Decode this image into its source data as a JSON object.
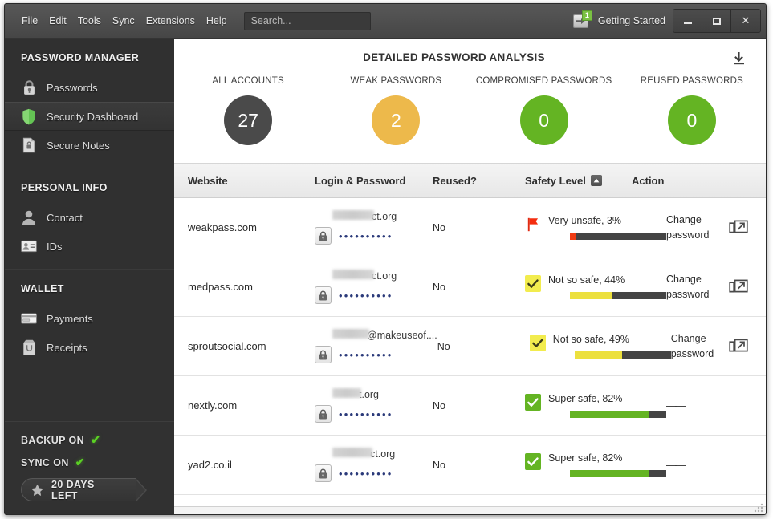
{
  "titlebar": {
    "menus": [
      "File",
      "Edit",
      "Tools",
      "Sync",
      "Extensions",
      "Help"
    ],
    "search_placeholder": "Search...",
    "getting_started_label": "Getting Started",
    "getting_started_badge": "1",
    "minimize_label": "Minimize",
    "maximize_label": "Maximize",
    "close_label": "✕"
  },
  "sidebar": {
    "sections": [
      {
        "title": "PASSWORD MANAGER",
        "items": [
          {
            "label": "Passwords",
            "icon": "lock-icon",
            "active": false
          },
          {
            "label": "Security Dashboard",
            "icon": "shield-icon",
            "active": true
          },
          {
            "label": "Secure Notes",
            "icon": "note-lock-icon",
            "active": false
          }
        ]
      },
      {
        "title": "PERSONAL INFO",
        "items": [
          {
            "label": "Contact",
            "icon": "person-icon",
            "active": false
          },
          {
            "label": "IDs",
            "icon": "id-card-icon",
            "active": false
          }
        ]
      },
      {
        "title": "WALLET",
        "items": [
          {
            "label": "Payments",
            "icon": "credit-card-icon",
            "active": false
          },
          {
            "label": "Receipts",
            "icon": "receipt-bag-icon",
            "active": false
          }
        ]
      }
    ],
    "footer": {
      "backup_label": "BACKUP ON",
      "backup_check": "✔",
      "sync_label": "SYNC ON",
      "sync_check": "✔",
      "trial_label": "20 DAYS LEFT",
      "trial_icon": "star-icon"
    }
  },
  "main": {
    "title": "DETAILED PASSWORD ANALYSIS",
    "download_icon": "download-icon",
    "stats": [
      {
        "label": "ALL ACCOUNTS",
        "value": "27",
        "color": "#4a4a4a"
      },
      {
        "label": "WEAK PASSWORDS",
        "value": "2",
        "color": "#edb94b"
      },
      {
        "label": "COMPROMISED PASSWORDS",
        "value": "0",
        "color": "#64b423"
      },
      {
        "label": "REUSED PASSWORDS",
        "value": "0",
        "color": "#64b423"
      }
    ],
    "table": {
      "columns": [
        "Website",
        "Login & Password",
        "Reused?",
        "Safety Level",
        "Action"
      ],
      "sorted_column": "Safety Level",
      "sort_direction": "asc",
      "password_mask": "••••••••••",
      "rows": [
        {
          "website": "weakpass.com",
          "login_redacted_width": 52,
          "login_tail": "ct.org",
          "reused": "No",
          "safety_label": "Very unsafe, 3%",
          "safety_percent": 3,
          "safety_color": "#f03c14",
          "safety_icon": "red-flag-icon",
          "action": "Change password",
          "has_launch_icon": true
        },
        {
          "website": "medpass.com",
          "login_redacted_width": 52,
          "login_tail": "ct.org",
          "reused": "No",
          "safety_label": "Not so safe, 44%",
          "safety_percent": 44,
          "safety_color": "#ece03e",
          "safety_icon": "yellow-check-icon",
          "action": "Change password",
          "has_launch_icon": true
        },
        {
          "website": "sproutsocial.com",
          "login_redacted_width": 46,
          "login_tail": "@makeuseof....",
          "reused": "No",
          "safety_label": "Not so safe, 49%",
          "safety_percent": 49,
          "safety_color": "#ece03e",
          "safety_icon": "yellow-check-icon",
          "action": "Change password",
          "has_launch_icon": true
        },
        {
          "website": "nextly.com",
          "login_redacted_width": 36,
          "login_tail": "t.org",
          "reused": "No",
          "safety_label": "Super safe, 82%",
          "safety_percent": 82,
          "safety_color": "#64b423",
          "safety_icon": "green-check-icon",
          "action": "——",
          "has_launch_icon": false
        },
        {
          "website": "yad2.co.il",
          "login_redacted_width": 50,
          "login_tail": "ct.org",
          "reused": "No",
          "safety_label": "Super safe, 82%",
          "safety_percent": 82,
          "safety_color": "#64b423",
          "safety_icon": "green-check-icon",
          "action": "——",
          "has_launch_icon": false
        }
      ]
    }
  }
}
